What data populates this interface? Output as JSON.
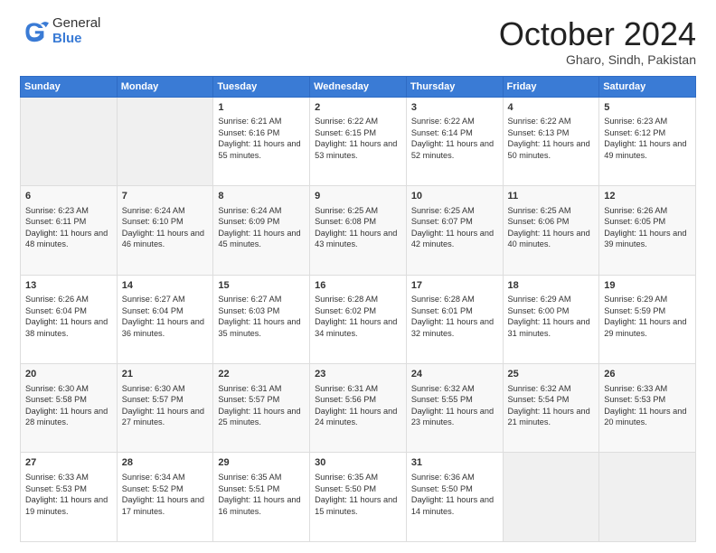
{
  "header": {
    "logo_line1": "General",
    "logo_line2": "Blue",
    "month": "October 2024",
    "location": "Gharo, Sindh, Pakistan"
  },
  "weekdays": [
    "Sunday",
    "Monday",
    "Tuesday",
    "Wednesday",
    "Thursday",
    "Friday",
    "Saturday"
  ],
  "weeks": [
    [
      {
        "day": "",
        "sunrise": "",
        "sunset": "",
        "daylight": ""
      },
      {
        "day": "",
        "sunrise": "",
        "sunset": "",
        "daylight": ""
      },
      {
        "day": "1",
        "sunrise": "Sunrise: 6:21 AM",
        "sunset": "Sunset: 6:16 PM",
        "daylight": "Daylight: 11 hours and 55 minutes."
      },
      {
        "day": "2",
        "sunrise": "Sunrise: 6:22 AM",
        "sunset": "Sunset: 6:15 PM",
        "daylight": "Daylight: 11 hours and 53 minutes."
      },
      {
        "day": "3",
        "sunrise": "Sunrise: 6:22 AM",
        "sunset": "Sunset: 6:14 PM",
        "daylight": "Daylight: 11 hours and 52 minutes."
      },
      {
        "day": "4",
        "sunrise": "Sunrise: 6:22 AM",
        "sunset": "Sunset: 6:13 PM",
        "daylight": "Daylight: 11 hours and 50 minutes."
      },
      {
        "day": "5",
        "sunrise": "Sunrise: 6:23 AM",
        "sunset": "Sunset: 6:12 PM",
        "daylight": "Daylight: 11 hours and 49 minutes."
      }
    ],
    [
      {
        "day": "6",
        "sunrise": "Sunrise: 6:23 AM",
        "sunset": "Sunset: 6:11 PM",
        "daylight": "Daylight: 11 hours and 48 minutes."
      },
      {
        "day": "7",
        "sunrise": "Sunrise: 6:24 AM",
        "sunset": "Sunset: 6:10 PM",
        "daylight": "Daylight: 11 hours and 46 minutes."
      },
      {
        "day": "8",
        "sunrise": "Sunrise: 6:24 AM",
        "sunset": "Sunset: 6:09 PM",
        "daylight": "Daylight: 11 hours and 45 minutes."
      },
      {
        "day": "9",
        "sunrise": "Sunrise: 6:25 AM",
        "sunset": "Sunset: 6:08 PM",
        "daylight": "Daylight: 11 hours and 43 minutes."
      },
      {
        "day": "10",
        "sunrise": "Sunrise: 6:25 AM",
        "sunset": "Sunset: 6:07 PM",
        "daylight": "Daylight: 11 hours and 42 minutes."
      },
      {
        "day": "11",
        "sunrise": "Sunrise: 6:25 AM",
        "sunset": "Sunset: 6:06 PM",
        "daylight": "Daylight: 11 hours and 40 minutes."
      },
      {
        "day": "12",
        "sunrise": "Sunrise: 6:26 AM",
        "sunset": "Sunset: 6:05 PM",
        "daylight": "Daylight: 11 hours and 39 minutes."
      }
    ],
    [
      {
        "day": "13",
        "sunrise": "Sunrise: 6:26 AM",
        "sunset": "Sunset: 6:04 PM",
        "daylight": "Daylight: 11 hours and 38 minutes."
      },
      {
        "day": "14",
        "sunrise": "Sunrise: 6:27 AM",
        "sunset": "Sunset: 6:04 PM",
        "daylight": "Daylight: 11 hours and 36 minutes."
      },
      {
        "day": "15",
        "sunrise": "Sunrise: 6:27 AM",
        "sunset": "Sunset: 6:03 PM",
        "daylight": "Daylight: 11 hours and 35 minutes."
      },
      {
        "day": "16",
        "sunrise": "Sunrise: 6:28 AM",
        "sunset": "Sunset: 6:02 PM",
        "daylight": "Daylight: 11 hours and 34 minutes."
      },
      {
        "day": "17",
        "sunrise": "Sunrise: 6:28 AM",
        "sunset": "Sunset: 6:01 PM",
        "daylight": "Daylight: 11 hours and 32 minutes."
      },
      {
        "day": "18",
        "sunrise": "Sunrise: 6:29 AM",
        "sunset": "Sunset: 6:00 PM",
        "daylight": "Daylight: 11 hours and 31 minutes."
      },
      {
        "day": "19",
        "sunrise": "Sunrise: 6:29 AM",
        "sunset": "Sunset: 5:59 PM",
        "daylight": "Daylight: 11 hours and 29 minutes."
      }
    ],
    [
      {
        "day": "20",
        "sunrise": "Sunrise: 6:30 AM",
        "sunset": "Sunset: 5:58 PM",
        "daylight": "Daylight: 11 hours and 28 minutes."
      },
      {
        "day": "21",
        "sunrise": "Sunrise: 6:30 AM",
        "sunset": "Sunset: 5:57 PM",
        "daylight": "Daylight: 11 hours and 27 minutes."
      },
      {
        "day": "22",
        "sunrise": "Sunrise: 6:31 AM",
        "sunset": "Sunset: 5:57 PM",
        "daylight": "Daylight: 11 hours and 25 minutes."
      },
      {
        "day": "23",
        "sunrise": "Sunrise: 6:31 AM",
        "sunset": "Sunset: 5:56 PM",
        "daylight": "Daylight: 11 hours and 24 minutes."
      },
      {
        "day": "24",
        "sunrise": "Sunrise: 6:32 AM",
        "sunset": "Sunset: 5:55 PM",
        "daylight": "Daylight: 11 hours and 23 minutes."
      },
      {
        "day": "25",
        "sunrise": "Sunrise: 6:32 AM",
        "sunset": "Sunset: 5:54 PM",
        "daylight": "Daylight: 11 hours and 21 minutes."
      },
      {
        "day": "26",
        "sunrise": "Sunrise: 6:33 AM",
        "sunset": "Sunset: 5:53 PM",
        "daylight": "Daylight: 11 hours and 20 minutes."
      }
    ],
    [
      {
        "day": "27",
        "sunrise": "Sunrise: 6:33 AM",
        "sunset": "Sunset: 5:53 PM",
        "daylight": "Daylight: 11 hours and 19 minutes."
      },
      {
        "day": "28",
        "sunrise": "Sunrise: 6:34 AM",
        "sunset": "Sunset: 5:52 PM",
        "daylight": "Daylight: 11 hours and 17 minutes."
      },
      {
        "day": "29",
        "sunrise": "Sunrise: 6:35 AM",
        "sunset": "Sunset: 5:51 PM",
        "daylight": "Daylight: 11 hours and 16 minutes."
      },
      {
        "day": "30",
        "sunrise": "Sunrise: 6:35 AM",
        "sunset": "Sunset: 5:50 PM",
        "daylight": "Daylight: 11 hours and 15 minutes."
      },
      {
        "day": "31",
        "sunrise": "Sunrise: 6:36 AM",
        "sunset": "Sunset: 5:50 PM",
        "daylight": "Daylight: 11 hours and 14 minutes."
      },
      {
        "day": "",
        "sunrise": "",
        "sunset": "",
        "daylight": ""
      },
      {
        "day": "",
        "sunrise": "",
        "sunset": "",
        "daylight": ""
      }
    ]
  ]
}
